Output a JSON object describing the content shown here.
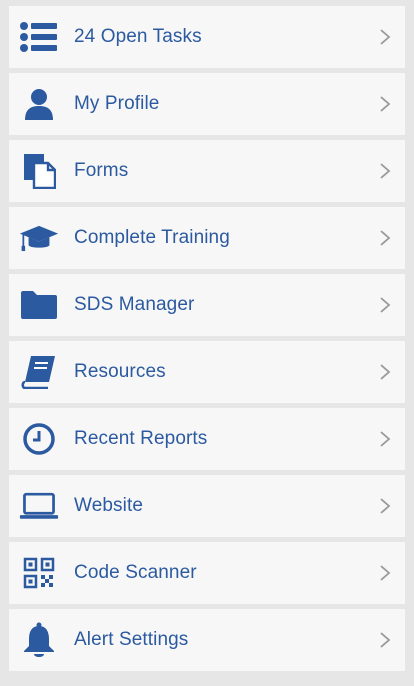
{
  "colors": {
    "accent": "#2c5aa0",
    "row_background": "#f7f7f7",
    "separator": "#e6e6e6",
    "chevron": "#9a9a9a"
  },
  "menu": {
    "items": [
      {
        "label": "24 Open Tasks",
        "icon": "list-icon"
      },
      {
        "label": "My Profile",
        "icon": "person-icon"
      },
      {
        "label": "Forms",
        "icon": "documents-icon"
      },
      {
        "label": "Complete Training",
        "icon": "graduation-cap-icon"
      },
      {
        "label": "SDS Manager",
        "icon": "folder-icon"
      },
      {
        "label": "Resources",
        "icon": "book-icon"
      },
      {
        "label": "Recent Reports",
        "icon": "clock-icon"
      },
      {
        "label": "Website",
        "icon": "laptop-icon"
      },
      {
        "label": "Code Scanner",
        "icon": "qr-code-icon"
      },
      {
        "label": "Alert Settings",
        "icon": "bell-icon"
      }
    ]
  }
}
